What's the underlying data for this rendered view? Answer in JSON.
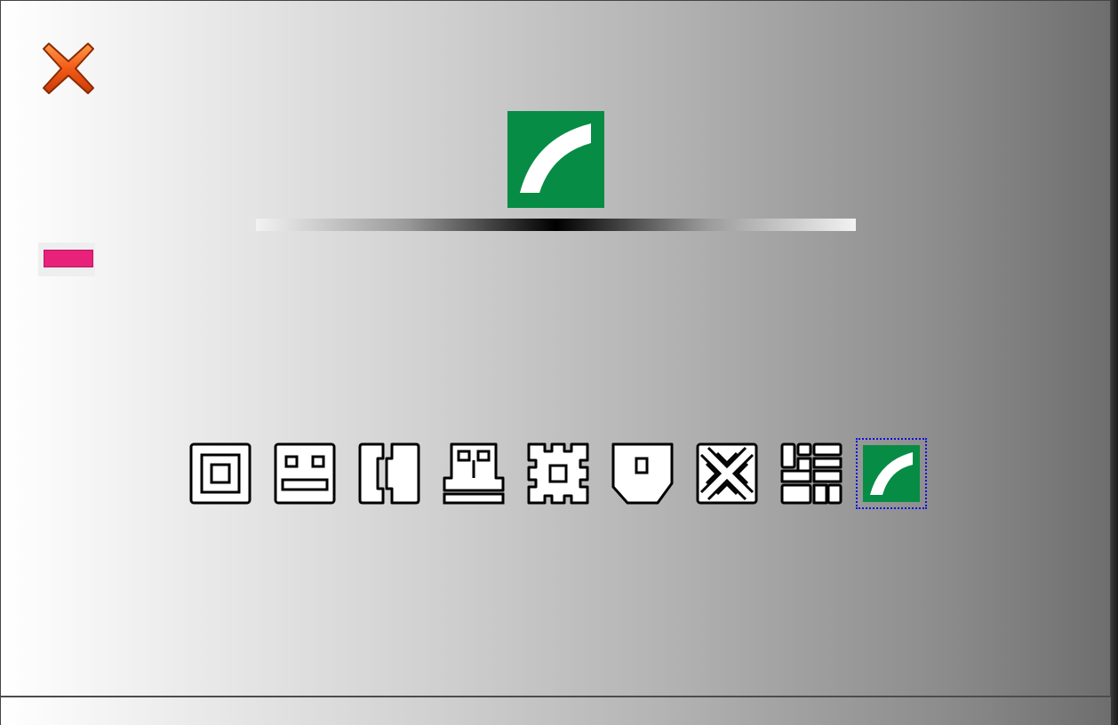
{
  "window": {
    "close_icon": "close-x-icon",
    "close_color": "#f05a14"
  },
  "action_button": {
    "color": "#e8217a"
  },
  "preview": {
    "icon": "green-arc-icon",
    "color": "#078c45"
  },
  "tiles": [
    {
      "icon": "nested-square-icon",
      "selected": false
    },
    {
      "icon": "face-square-icon",
      "selected": false
    },
    {
      "icon": "bracket-split-icon",
      "selected": false
    },
    {
      "icon": "house-windows-icon",
      "selected": false
    },
    {
      "icon": "cog-square-icon",
      "selected": false
    },
    {
      "icon": "pentagon-square-icon",
      "selected": false
    },
    {
      "icon": "x-weave-icon",
      "selected": false
    },
    {
      "icon": "grid-blocks-icon",
      "selected": false
    },
    {
      "icon": "green-arc-icon",
      "selected": true
    }
  ]
}
